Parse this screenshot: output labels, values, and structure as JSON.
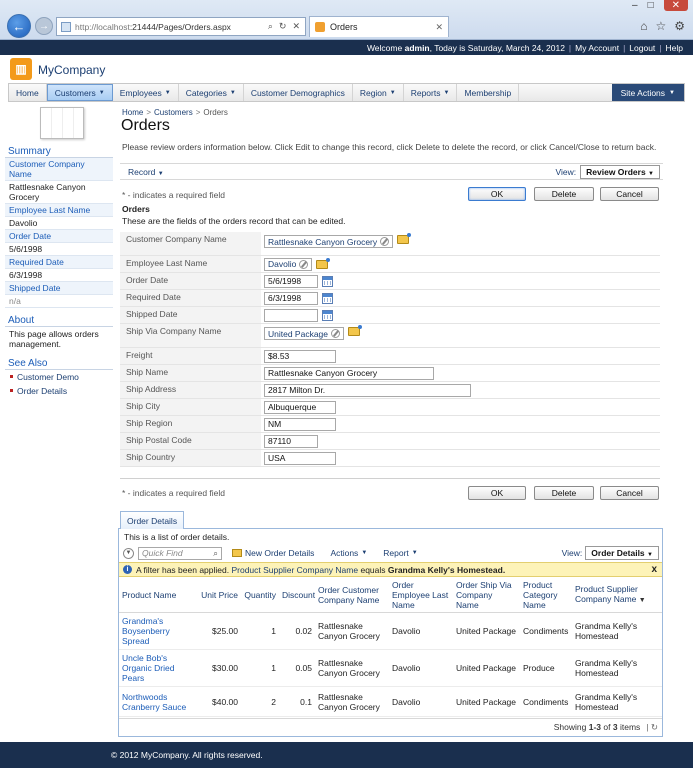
{
  "browser": {
    "url_host": "http://localhost",
    "url_path": ":21444/Pages/Orders.aspx",
    "tab_title": "Orders",
    "min": "–",
    "max": "□",
    "close": "✕"
  },
  "topbar": {
    "welcome_prefix": "Welcome ",
    "user": "admin",
    "date_text": ", Today is Saturday, March 24, 2012",
    "my_account": "My Account",
    "logout": "Logout",
    "help": "Help"
  },
  "brand": {
    "name": "MyCompany"
  },
  "menu": {
    "items": [
      "Home",
      "Customers",
      "Employees",
      "Categories",
      "Customer Demographics",
      "Region",
      "Reports",
      "Membership"
    ],
    "site_actions": "Site Actions"
  },
  "sidebar": {
    "summary_title": "Summary",
    "fields": [
      {
        "label": "Customer Company Name",
        "value": "Rattlesnake Canyon Grocery"
      },
      {
        "label": "Employee Last Name",
        "value": "Davolio"
      },
      {
        "label": "Order Date",
        "value": "5/6/1998"
      },
      {
        "label": "Required Date",
        "value": "6/3/1998"
      },
      {
        "label": "Shipped Date",
        "value": "n/a"
      }
    ],
    "about_title": "About",
    "about_text": "This page allows orders management.",
    "see_also_title": "See Also",
    "links": [
      "Customer Demo",
      "Order Details"
    ]
  },
  "breadcrumb": {
    "home": "Home",
    "customers": "Customers",
    "current": "Orders",
    "sep": ">"
  },
  "page": {
    "title": "Orders",
    "description": "Please review orders information below. Click Edit to change this record, click Delete to delete the record, or click Cancel/Close to return back."
  },
  "record_bar": {
    "record_label": "Record",
    "view_label": "View:",
    "view_value": "Review Orders"
  },
  "form": {
    "required_note": "* - indicates a required field",
    "ok": "OK",
    "delete": "Delete",
    "cancel": "Cancel",
    "section_title": "Orders",
    "section_desc": "These are the fields of the orders record that can be edited.",
    "fields": {
      "customer": {
        "label": "Customer Company Name",
        "value": "Rattlesnake Canyon Grocery"
      },
      "employee": {
        "label": "Employee Last Name",
        "value": "Davolio"
      },
      "order_date": {
        "label": "Order Date",
        "value": "5/6/1998"
      },
      "required_date": {
        "label": "Required Date",
        "value": "6/3/1998"
      },
      "shipped_date": {
        "label": "Shipped Date",
        "value": ""
      },
      "ship_via": {
        "label": "Ship Via Company Name",
        "value": "United Package"
      },
      "freight": {
        "label": "Freight",
        "value": "$8.53"
      },
      "ship_name": {
        "label": "Ship Name",
        "value": "Rattlesnake Canyon Grocery"
      },
      "ship_address": {
        "label": "Ship Address",
        "value": "2817 Milton Dr."
      },
      "ship_city": {
        "label": "Ship City",
        "value": "Albuquerque"
      },
      "ship_region": {
        "label": "Ship Region",
        "value": "NM"
      },
      "ship_postal": {
        "label": "Ship Postal Code",
        "value": "87110"
      },
      "ship_country": {
        "label": "Ship Country",
        "value": "USA"
      }
    }
  },
  "details": {
    "tab": "Order Details",
    "desc": "This is a list of order details.",
    "quick_find_placeholder": "Quick Find",
    "new_btn": "New Order Details",
    "actions": "Actions",
    "report": "Report",
    "view_label": "View:",
    "view_value": "Order Details",
    "filter_prefix": "A filter has been applied.",
    "filter_field": "Product Supplier Company Name",
    "filter_op": "equals",
    "filter_value": "Grandma Kelly's Homestead.",
    "filter_close": "x",
    "columns": [
      "Product Name",
      "Unit Price",
      "Quantity",
      "Discount",
      "Order Customer Company Name",
      "Order Employee Last Name",
      "Order Ship Via Company Name",
      "Product Category Name",
      "Product Supplier Company Name"
    ],
    "rows": [
      [
        "Grandma's Boysenberry Spread",
        "$25.00",
        "1",
        "0.02",
        "Rattlesnake Canyon Grocery",
        "Davolio",
        "United Package",
        "Condiments",
        "Grandma Kelly's Homestead"
      ],
      [
        "Uncle Bob's Organic Dried Pears",
        "$30.00",
        "1",
        "0.05",
        "Rattlesnake Canyon Grocery",
        "Davolio",
        "United Package",
        "Produce",
        "Grandma Kelly's Homestead"
      ],
      [
        "Northwoods Cranberry Sauce",
        "$40.00",
        "2",
        "0.1",
        "Rattlesnake Canyon Grocery",
        "Davolio",
        "United Package",
        "Condiments",
        "Grandma Kelly's Homestead"
      ]
    ],
    "pager_showing": "Showing",
    "pager_range": "1-3",
    "pager_of": "of",
    "pager_total": "3",
    "pager_items": "items"
  },
  "footer": {
    "text": "© 2012 MyCompany. All rights reserved."
  }
}
